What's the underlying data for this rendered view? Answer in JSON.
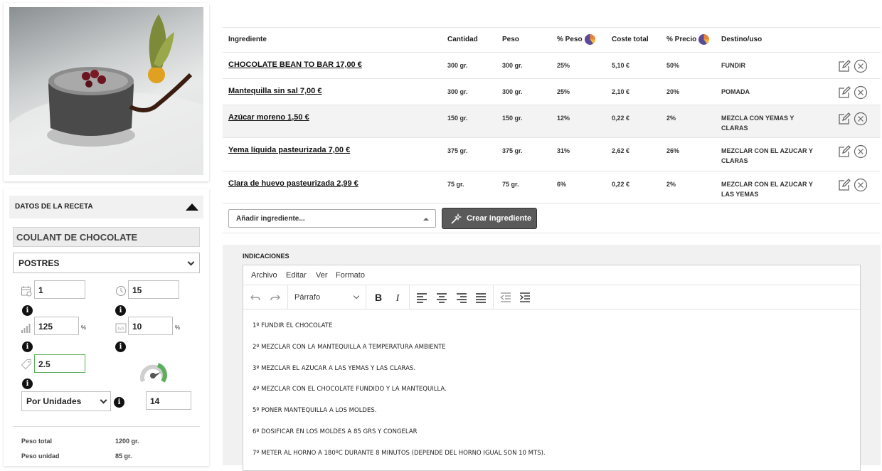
{
  "recipe": {
    "section_title": "DATOS DE LA RECETA",
    "name": "COULANT DE CHOCOLATE",
    "category": "POSTRES",
    "raciones": "1",
    "tiempo": "15",
    "merma": "125",
    "merma_unit": "%",
    "iva": "10",
    "iva_unit": "%",
    "precio": "2.5",
    "unit_mode": "Por Unidades",
    "unidades": "14",
    "info_glyph": "i",
    "stats": [
      {
        "label": "Peso total",
        "value": "1200 gr."
      },
      {
        "label": "Peso unidad",
        "value": "85 gr."
      }
    ]
  },
  "table": {
    "headers": {
      "ingrediente": "Ingrediente",
      "cantidad": "Cantidad",
      "peso": "Peso",
      "pct_peso": "% Peso",
      "coste": "Coste total",
      "pct_precio": "% Precio",
      "destino": "Destino/uso"
    },
    "rows": [
      {
        "name": "CHOCOLATE BEAN TO BAR 17,00 €",
        "cantidad": "300 gr.",
        "peso": "300 gr.",
        "pct_peso": "25%",
        "coste": "5,10 €",
        "pct_precio": "50%",
        "destino": "FUNDIR"
      },
      {
        "name": "Mantequilla sin sal 7,00 €",
        "cantidad": "300 gr.",
        "peso": "300 gr.",
        "pct_peso": "25%",
        "coste": "2,10 €",
        "pct_precio": "20%",
        "destino": "POMADA"
      },
      {
        "name": "Azúcar moreno 1,50 €",
        "cantidad": "150 gr.",
        "peso": "150 gr.",
        "pct_peso": "12%",
        "coste": "0,22 €",
        "pct_precio": "2%",
        "destino": "MEZCLA CON YEMAS Y CLARAS"
      },
      {
        "name": "Yema líquida pasteurizada 7,00 €",
        "cantidad": "375 gr.",
        "peso": "375 gr.",
        "pct_peso": "31%",
        "coste": "2,62 €",
        "pct_precio": "26%",
        "destino": "MEZCLAR CON EL AZUCAR Y CLARAS"
      },
      {
        "name": "Clara de huevo pasteurizada 2,99 €",
        "cantidad": "75 gr.",
        "peso": "75 gr.",
        "pct_peso": "6%",
        "coste": "0,22 €",
        "pct_precio": "2%",
        "destino": "MEZCLAR CON EL AZUCAR Y LAS YEMAS"
      }
    ],
    "add_placeholder": "Añadir ingrediente...",
    "create_button": "Crear ingrediente"
  },
  "indicaciones": {
    "title": "INDICACIONES",
    "menu": [
      "Archivo",
      "Editar",
      "Ver",
      "Formato"
    ],
    "format_block": "Párrafo",
    "steps": [
      "1º FUNDIR EL CHOCOLATE",
      "2º MEZCLAR CON LA MANTEQUILLA A TEMPERATURA AMBIENTE",
      "3º MEZCLAR EL AZUCAR A LAS YEMAS Y LAS CLARAS.",
      "4º MEZCLAR CON EL CHOCOLATE FUNDIDO Y LA MANTEQUILLA.",
      "5º PONER MANTEQUILLA A LOS MOLDES.",
      "6º DOSIFICAR EN LOS MOLDES A 85 GRS Y CONGELAR",
      "7º METER AL HORNO A 180ºC DURANTE 8 MINUTOS (DEPENDE DEL HORNO IGUAL SON 10 MTS)."
    ]
  },
  "colors": {
    "pie_purple": "#5b4a9a",
    "pie_orange": "#e8833a",
    "gauge_green": "#5cae5c",
    "button_dark": "#5a5a5a"
  }
}
